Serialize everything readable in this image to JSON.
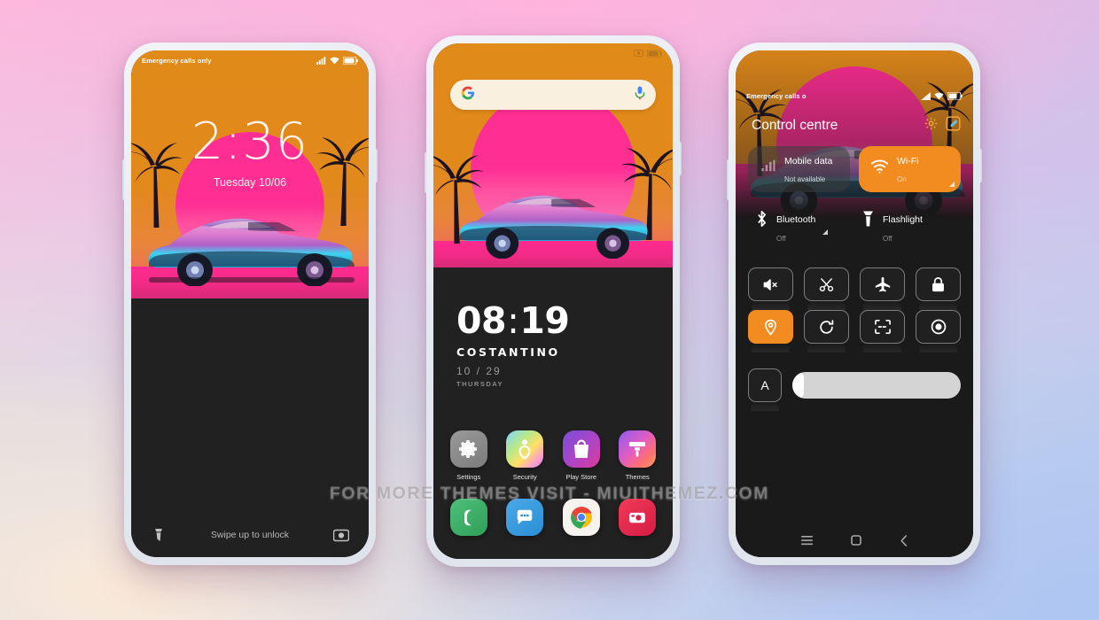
{
  "watermark": "FOR MORE THEMES VISIT - MIUITHEMEZ.COM",
  "colors": {
    "accent_orange": "#f28c20",
    "sky_orange": "#e2891c",
    "sun_pink": "#ff2e93",
    "screen_dark": "#1a1a1a",
    "search_cream": "#faf0e0"
  },
  "lockscreen": {
    "status_carrier": "Emergency calls only",
    "status_icons": [
      "signal-icon",
      "wifi-icon",
      "battery-icon"
    ],
    "time": "2:36",
    "date": "Tuesday 10/06",
    "hint": "Swipe up to unlock",
    "left_icon": "flashlight-icon",
    "right_icon": "camera-icon"
  },
  "homescreen": {
    "status_icons": [
      "screen-record-icon",
      "battery-icon"
    ],
    "search": {
      "placeholder": "",
      "value": "",
      "leading_icon": "google-g-icon",
      "trailing_icon": "microphone-icon"
    },
    "clock": {
      "hours": "08",
      "separator": ":",
      "minutes": "19",
      "name": "COSTANTINO",
      "date": "10 / 29",
      "weekday": "THURSDAY"
    },
    "apps": [
      {
        "label": "Settings",
        "icon": "gear-icon"
      },
      {
        "label": "Security",
        "icon": "security-shield-icon"
      },
      {
        "label": "Play Store",
        "icon": "shopping-bag-icon"
      },
      {
        "label": "Themes",
        "icon": "paint-roller-icon"
      }
    ],
    "dock": [
      {
        "label": "Phone",
        "icon": "phone-icon"
      },
      {
        "label": "Messages",
        "icon": "message-bubble-icon"
      },
      {
        "label": "Chrome",
        "icon": "chrome-icon"
      },
      {
        "label": "Camera",
        "icon": "camera-icon"
      }
    ]
  },
  "controlcentre": {
    "status_carrier": "Emergency calls o",
    "title": "Control centre",
    "header_icons": [
      "gear-icon",
      "edit-icon"
    ],
    "big_toggles": [
      {
        "name": "Mobile data",
        "state": "Not available",
        "icon": "mobile-data-icon",
        "active": false
      },
      {
        "name": "Wi-Fi",
        "state": "On",
        "icon": "wifi-icon",
        "active": true
      }
    ],
    "mid_toggles": [
      {
        "name": "Bluetooth",
        "state": "Off",
        "icon": "bluetooth-icon"
      },
      {
        "name": "Flashlight",
        "state": "Off",
        "icon": "flashlight-icon"
      }
    ],
    "tiles": [
      {
        "icon": "mute-icon",
        "active": false
      },
      {
        "icon": "scissors-icon",
        "active": false
      },
      {
        "icon": "airplane-icon",
        "active": false
      },
      {
        "icon": "lock-icon",
        "active": false
      },
      {
        "icon": "location-pin-icon",
        "active": true
      },
      {
        "icon": "rotate-icon",
        "active": false
      },
      {
        "icon": "scan-icon",
        "active": false
      },
      {
        "icon": "eye-icon",
        "active": false
      }
    ],
    "brightness": {
      "auto_label": "A",
      "value_percent": 93
    },
    "navbar": [
      "recents-icon",
      "home-icon",
      "back-icon"
    ]
  }
}
